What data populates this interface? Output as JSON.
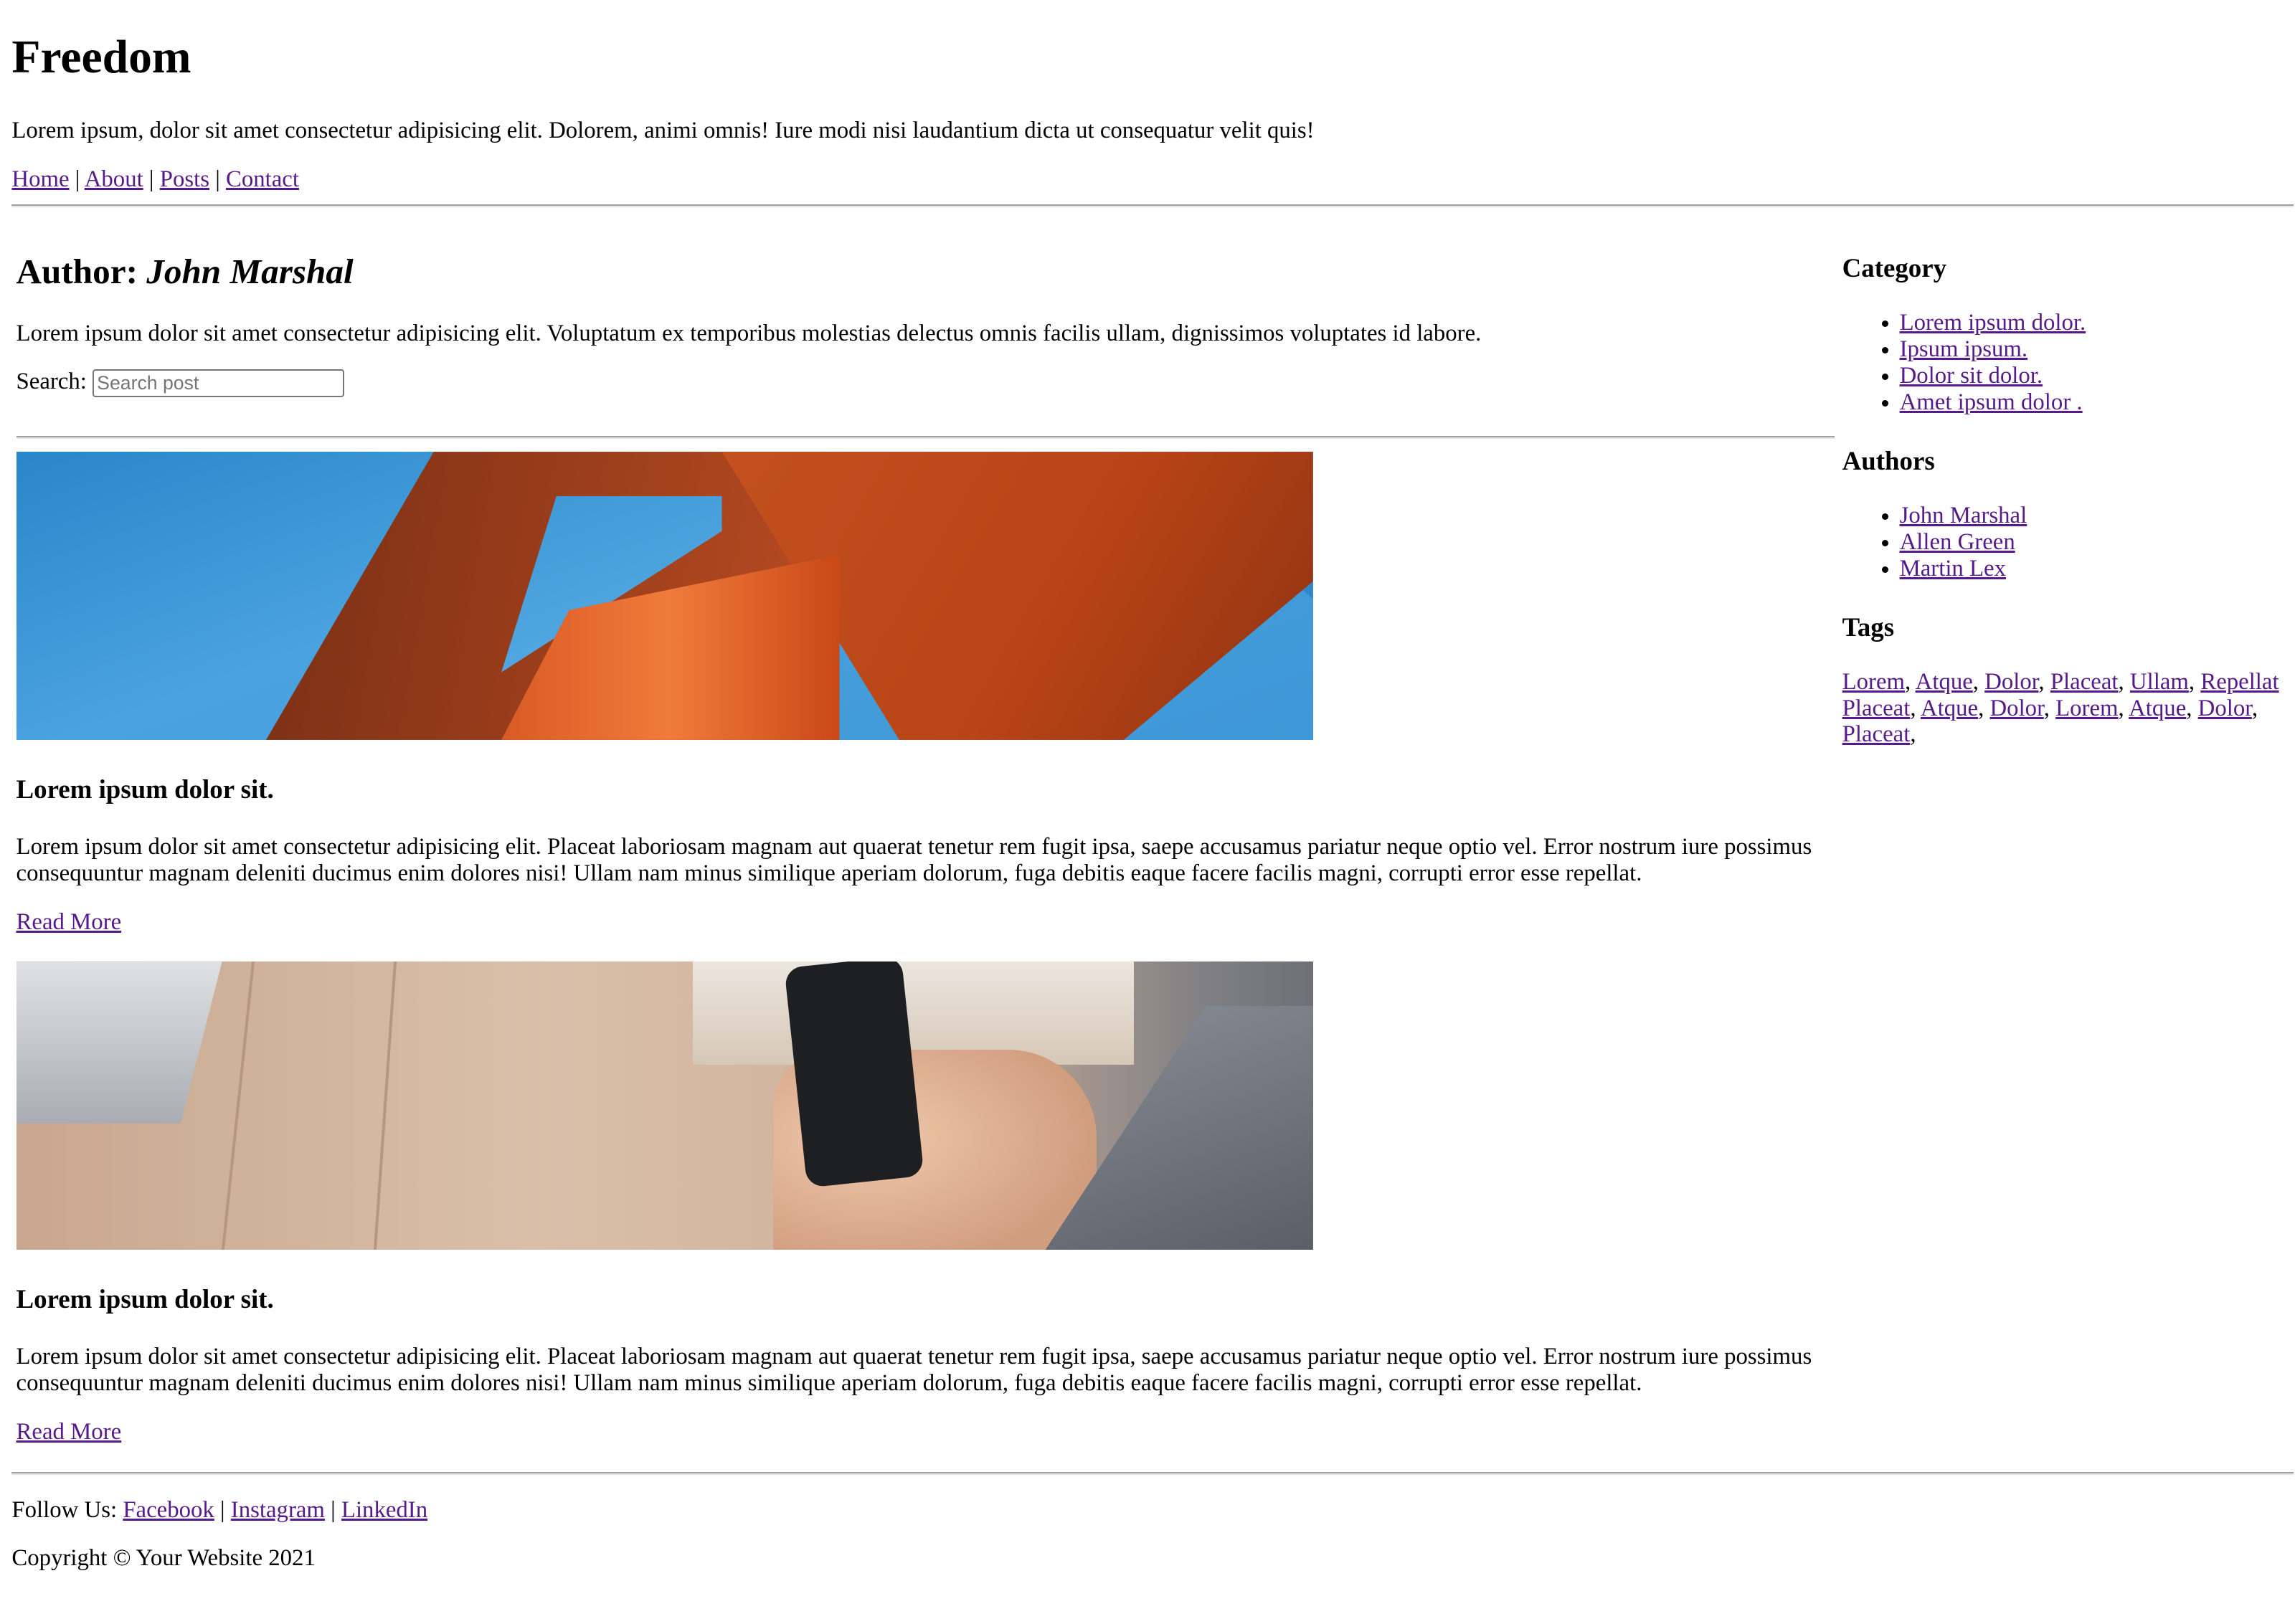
{
  "site": {
    "title": "Freedom",
    "tagline": "Lorem ipsum, dolor sit amet consectetur adipisicing elit. Dolorem, animi omnis! Iure modi nisi laudantium dicta ut consequatur velit quis!",
    "nav": [
      {
        "label": "Home"
      },
      {
        "label": "About"
      },
      {
        "label": "Posts"
      },
      {
        "label": "Contact"
      }
    ],
    "nav_separator": "|"
  },
  "author": {
    "heading_prefix": "Author:",
    "name": "John Marshal",
    "intro": "Lorem ipsum dolor sit amet consectetur adipisicing elit. Voluptatum ex temporibus molestias delectus omnis facilis ullam, dignissimos voluptates id labore."
  },
  "search": {
    "label": "Search:",
    "placeholder": "Search post"
  },
  "posts": [
    {
      "title": "Lorem ipsum dolor sit.",
      "excerpt": "Lorem ipsum dolor sit amet consectetur adipisicing elit. Placeat laboriosam magnam aut quaerat tenetur rem fugit ipsa, saepe accusamus pariatur neque optio vel. Error nostrum iure possimus consequuntur magnam deleniti ducimus enim dolores nisi! Ullam nam minus similique aperiam dolorum, fuga debitis eaque facere facilis magni, corrupti error esse repellat.",
      "read_more": "Read More"
    },
    {
      "title": "Lorem ipsum dolor sit.",
      "excerpt": "Lorem ipsum dolor sit amet consectetur adipisicing elit. Placeat laboriosam magnam aut quaerat tenetur rem fugit ipsa, saepe accusamus pariatur neque optio vel. Error nostrum iure possimus consequuntur magnam deleniti ducimus enim dolores nisi! Ullam nam minus similique aperiam dolorum, fuga debitis eaque facere facilis magni, corrupti error esse repellat.",
      "read_more": "Read More"
    }
  ],
  "sidebar": {
    "category": {
      "heading": "Category",
      "items": [
        "Lorem ipsum dolor.",
        "Ipsum ipsum.",
        "Dolor sit dolor.",
        "Amet ipsum dolor ."
      ]
    },
    "authors": {
      "heading": "Authors",
      "items": [
        "John Marshal",
        "Allen Green",
        "Martin Lex"
      ]
    },
    "tags": {
      "heading": "Tags",
      "items": [
        "Lorem",
        "Atque",
        "Dolor",
        "Placeat",
        "Ullam",
        "Repellat",
        "Placeat",
        "Atque",
        "Dolor",
        "Lorem",
        "Atque",
        "Dolor",
        "Placeat"
      ]
    }
  },
  "footer": {
    "follow_label": "Follow Us:",
    "social": [
      {
        "label": "Facebook"
      },
      {
        "label": "Instagram"
      },
      {
        "label": "LinkedIn"
      }
    ],
    "copyright": "Copyright © Your Website 2021"
  },
  "colors": {
    "link": "#551a8b",
    "text": "#000000",
    "background": "#ffffff"
  }
}
